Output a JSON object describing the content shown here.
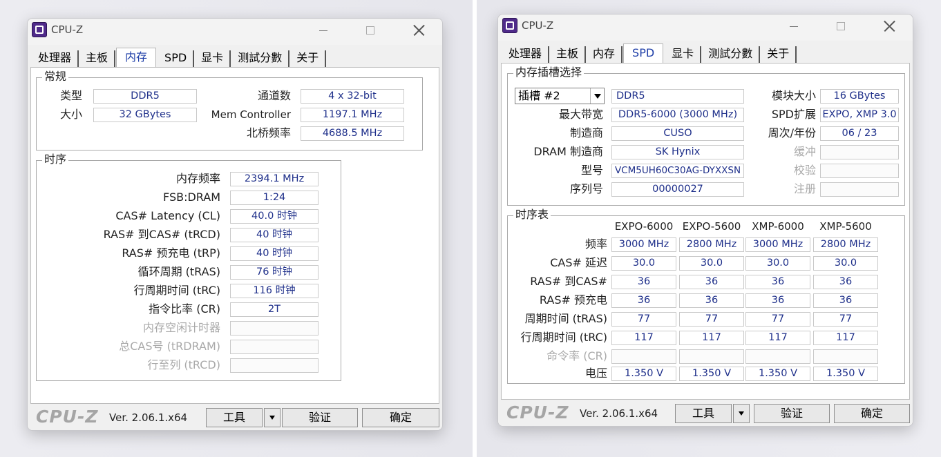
{
  "left_window": {
    "title": "CPU-Z",
    "tabs": [
      "处理器",
      "主板",
      "内存",
      "SPD",
      "显卡",
      "测試分數",
      "关于"
    ],
    "active_tab": "内存",
    "general": {
      "title": "常规",
      "type_label": "类型",
      "type_value": "DDR5",
      "size_label": "大小",
      "size_value": "32 GBytes",
      "channels_label": "通道数",
      "channels_value": "4 x 32-bit",
      "memctrl_label": "Mem Controller",
      "memctrl_value": "1197.1 MHz",
      "nb_label": "北桥频率",
      "nb_value": "4688.5 MHz"
    },
    "timings": {
      "title": "时序",
      "rows": [
        {
          "label": "内存频率",
          "value": "2394.1 MHz"
        },
        {
          "label": "FSB:DRAM",
          "value": "1:24"
        },
        {
          "label": "CAS# Latency (CL)",
          "value": "40.0 时钟"
        },
        {
          "label": "RAS# 到CAS# (tRCD)",
          "value": "40 时钟"
        },
        {
          "label": "RAS# 预充电 (tRP)",
          "value": "40 时钟"
        },
        {
          "label": "循环周期 (tRAS)",
          "value": "76 时钟"
        },
        {
          "label": "行周期时间 (tRC)",
          "value": "116 时钟"
        },
        {
          "label": "指令比率 (CR)",
          "value": "2T"
        },
        {
          "label": "内存空闲计时器",
          "value": ""
        },
        {
          "label": "总CAS号 (tRDRAM)",
          "value": ""
        },
        {
          "label": "行至列 (tRCD)",
          "value": ""
        }
      ]
    },
    "footer": {
      "logo": "CPU-Z",
      "version": "Ver. 2.06.1.x64",
      "tools": "工具",
      "validate": "验证",
      "ok": "确定"
    }
  },
  "right_window": {
    "title": "CPU-Z",
    "tabs": [
      "处理器",
      "主板",
      "内存",
      "SPD",
      "显卡",
      "测試分數",
      "关于"
    ],
    "active_tab": "SPD",
    "slot": {
      "title": "内存插槽选择",
      "selected_slot": "插槽 #2",
      "type_value": "DDR5",
      "module_size_label": "模块大小",
      "module_size_value": "16 GBytes",
      "max_bw_label": "最大带宽",
      "max_bw_value": "DDR5-6000 (3000 MHz)",
      "spd_ext_label": "SPD扩展",
      "spd_ext_value": "EXPO, XMP 3.0",
      "mfr_label": "制造商",
      "mfr_value": "CUSO",
      "week_year_label": "周次/年份",
      "week_year_value": "06 / 23",
      "dram_mfr_label": "DRAM 制造商",
      "dram_mfr_value": "SK Hynix",
      "buffer_label": "缓冲",
      "part_label": "型号",
      "part_value": "VCM5UH60C30AG-DYXXSN",
      "check_label": "校验",
      "serial_label": "序列号",
      "serial_value": "00000027",
      "reg_label": "注册"
    },
    "timing_table": {
      "title": "时序表",
      "columns": [
        "EXPO-6000",
        "EXPO-5600",
        "XMP-6000",
        "XMP-5600"
      ],
      "rows": [
        {
          "label": "频率",
          "values": [
            "3000 MHz",
            "2800 MHz",
            "3000 MHz",
            "2800 MHz"
          ]
        },
        {
          "label": "CAS# 延迟",
          "values": [
            "30.0",
            "30.0",
            "30.0",
            "30.0"
          ]
        },
        {
          "label": "RAS# 到CAS#",
          "values": [
            "36",
            "36",
            "36",
            "36"
          ]
        },
        {
          "label": "RAS# 预充电",
          "values": [
            "36",
            "36",
            "36",
            "36"
          ]
        },
        {
          "label": "周期时间 (tRAS)",
          "values": [
            "77",
            "77",
            "77",
            "77"
          ]
        },
        {
          "label": "行周期时间 (tRC)",
          "values": [
            "117",
            "117",
            "117",
            "117"
          ]
        },
        {
          "label": "命令率 (CR)",
          "values": [
            "",
            "",
            "",
            ""
          ]
        },
        {
          "label": "电压",
          "values": [
            "1.350 V",
            "1.350 V",
            "1.350 V",
            "1.350 V"
          ]
        }
      ]
    },
    "footer": {
      "logo": "CPU-Z",
      "version": "Ver. 2.06.1.x64",
      "tools": "工具",
      "validate": "验证",
      "ok": "确定"
    }
  }
}
